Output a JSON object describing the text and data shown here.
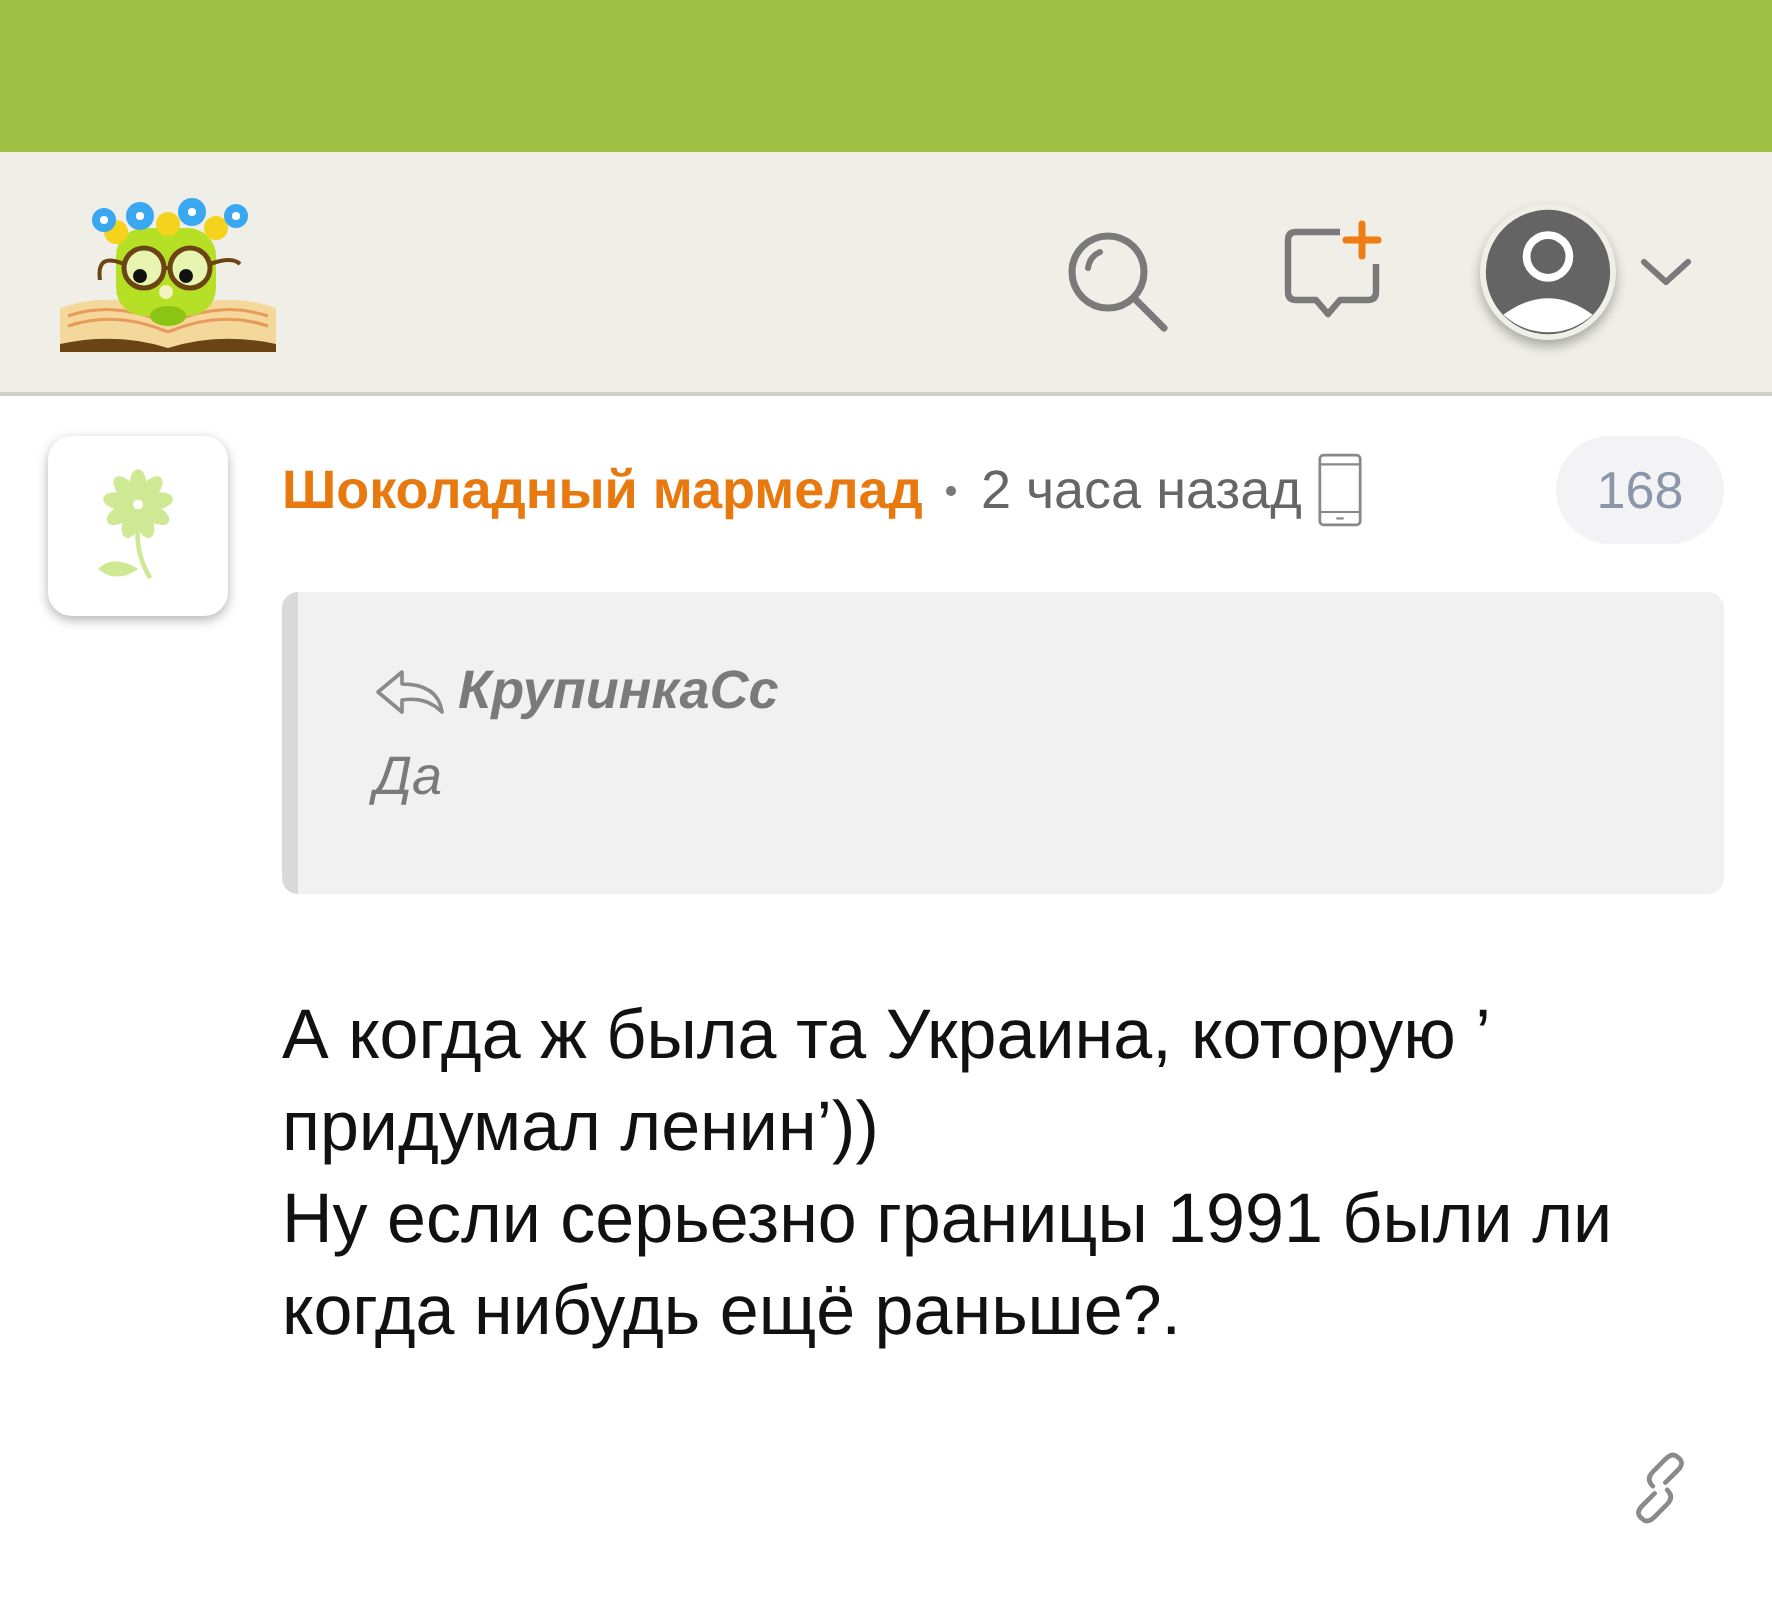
{
  "comment": {
    "author": "Шоколадный мармелад",
    "time": "2 часа назад",
    "count": "168",
    "quote": {
      "author": "КрупинкаСс",
      "text": "Да"
    },
    "body": "А когда ж была та Украина, которую ’ придумал ленин’))\nНу если серьезно границы 1991 были ли когда нибудь ещё раньше?."
  }
}
